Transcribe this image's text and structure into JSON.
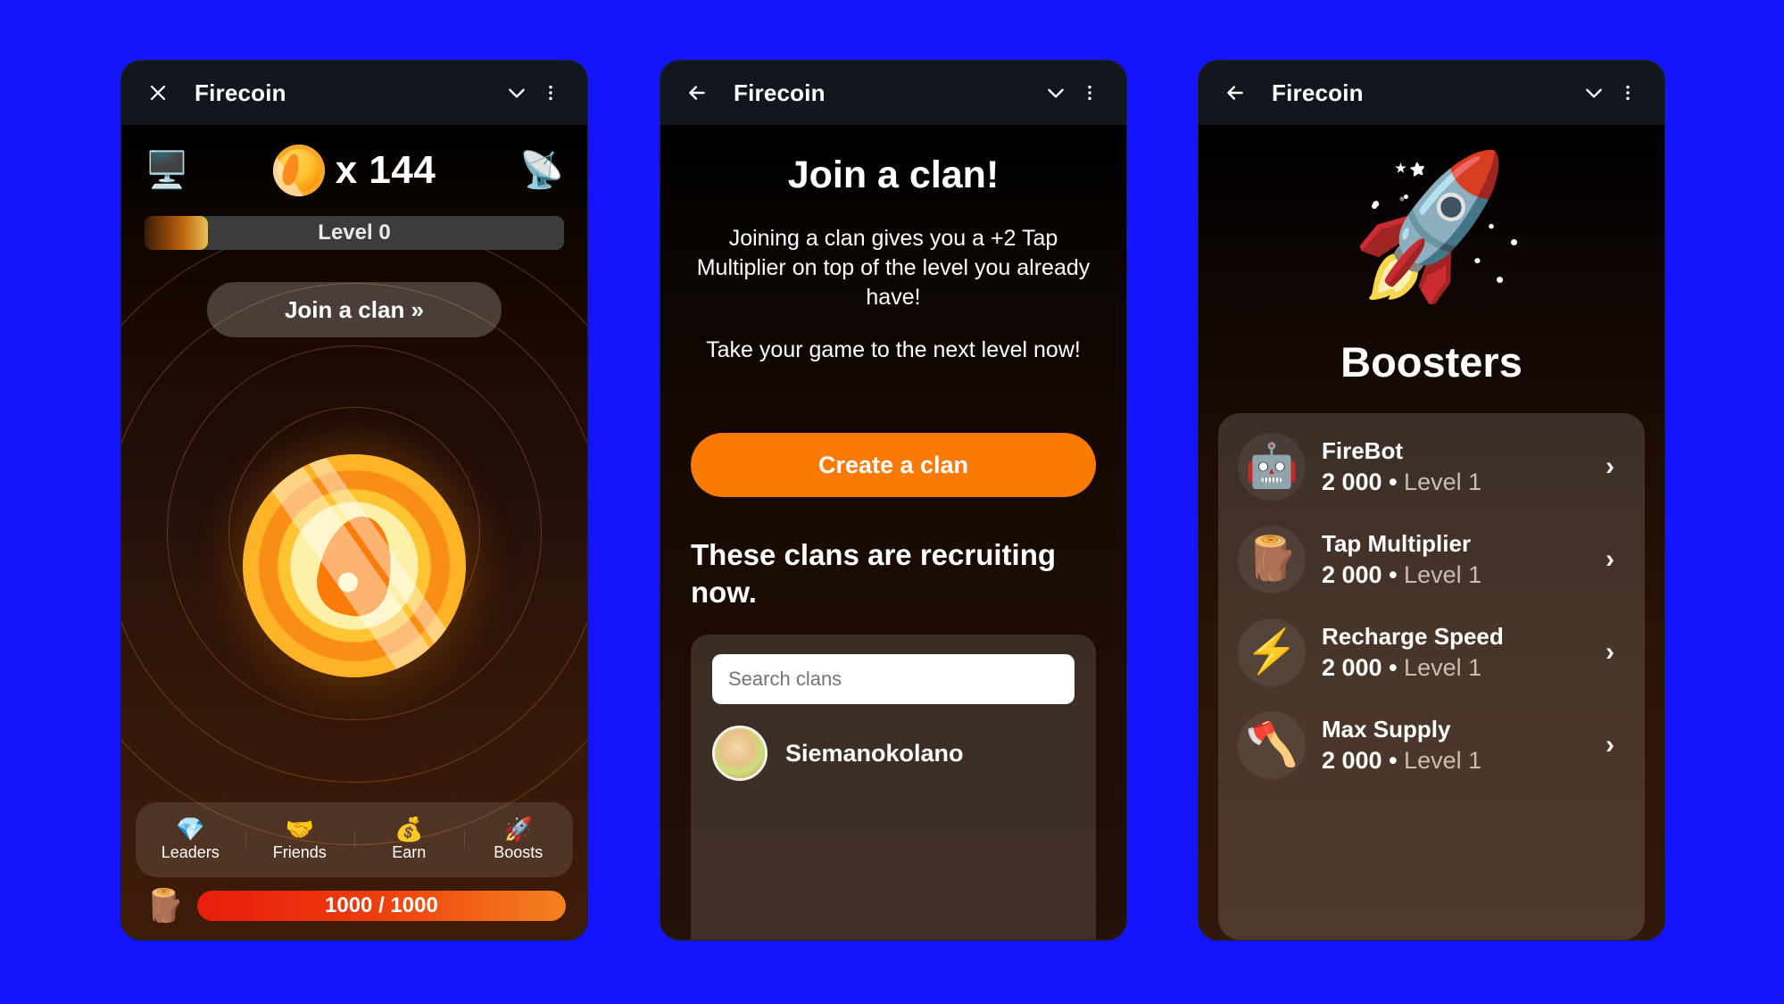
{
  "theme": {
    "page_background": "#1414FF",
    "accent_orange": "#F97B06",
    "energy_bar_from": "#E81D0C",
    "energy_bar_to": "#F5821F",
    "appbar_background": "#12171F"
  },
  "phone1": {
    "appbar": {
      "close_icon": "close-icon",
      "title": "Firecoin",
      "chevron_icon": "chevron-down-icon",
      "menu_icon": "more-vertical-icon"
    },
    "stats": {
      "left_icon": "desktop-computer-icon",
      "left_emoji": "🖥️",
      "coin_icon": "firecoin-icon",
      "count": "x 144",
      "right_icon": "satellite-antenna-icon",
      "right_emoji": "📡"
    },
    "level": {
      "label": "Level 0",
      "progress_percent": 15
    },
    "join_clan_button": "Join a clan »",
    "coin": {
      "icon": "firecoin-tap-target"
    },
    "nav": [
      {
        "icon": "gem-icon",
        "emoji": "💎",
        "label": "Leaders"
      },
      {
        "icon": "handshake-icon",
        "emoji": "🤝",
        "label": "Friends"
      },
      {
        "icon": "money-bag-icon",
        "emoji": "💰",
        "label": "Earn"
      },
      {
        "icon": "rocket-icon",
        "emoji": "🚀",
        "label": "Boosts"
      }
    ],
    "energy": {
      "icon": "wood-log-icon",
      "emoji": "🪵",
      "text": "1000 / 1000",
      "percent": 100
    }
  },
  "phone2": {
    "appbar": {
      "back_icon": "arrow-left-icon",
      "title": "Firecoin",
      "chevron_icon": "chevron-down-icon",
      "menu_icon": "more-vertical-icon"
    },
    "title": "Join a clan!",
    "paragraph_1": "Joining a clan gives you a +2 Tap Multiplier on top of the level you already have!",
    "paragraph_2": "Take your game to the next level now!",
    "create_button": "Create a clan",
    "recruiting_heading": "These clans are recruiting now.",
    "search_placeholder": "Search clans",
    "search_value": "",
    "clans": [
      {
        "name": "Siemanokolano",
        "avatar": "clan-avatar"
      }
    ]
  },
  "phone3": {
    "appbar": {
      "back_icon": "arrow-left-icon",
      "title": "Firecoin",
      "chevron_icon": "chevron-down-icon",
      "menu_icon": "more-vertical-icon"
    },
    "hero_icon": "rocket-icon",
    "hero_emoji": "🚀",
    "title": "Boosters",
    "boosters": [
      {
        "icon": "robot-icon",
        "emoji": "🤖",
        "name": "FireBot",
        "price": "2 000",
        "separator": " • ",
        "level": "Level 1",
        "chevron": "›"
      },
      {
        "icon": "wood-log-icon",
        "emoji": "🪵",
        "name": "Tap Multiplier",
        "price": "2 000",
        "separator": " • ",
        "level": "Level 1",
        "chevron": "›"
      },
      {
        "icon": "lightning-icon",
        "emoji": "⚡",
        "name": "Recharge Speed",
        "price": "2 000",
        "separator": " • ",
        "level": "Level 1",
        "chevron": "›"
      },
      {
        "icon": "axe-icon",
        "emoji": "🪓",
        "name": "Max Supply",
        "price": "2 000",
        "separator": " • ",
        "level": "Level 1",
        "chevron": "›"
      }
    ]
  }
}
